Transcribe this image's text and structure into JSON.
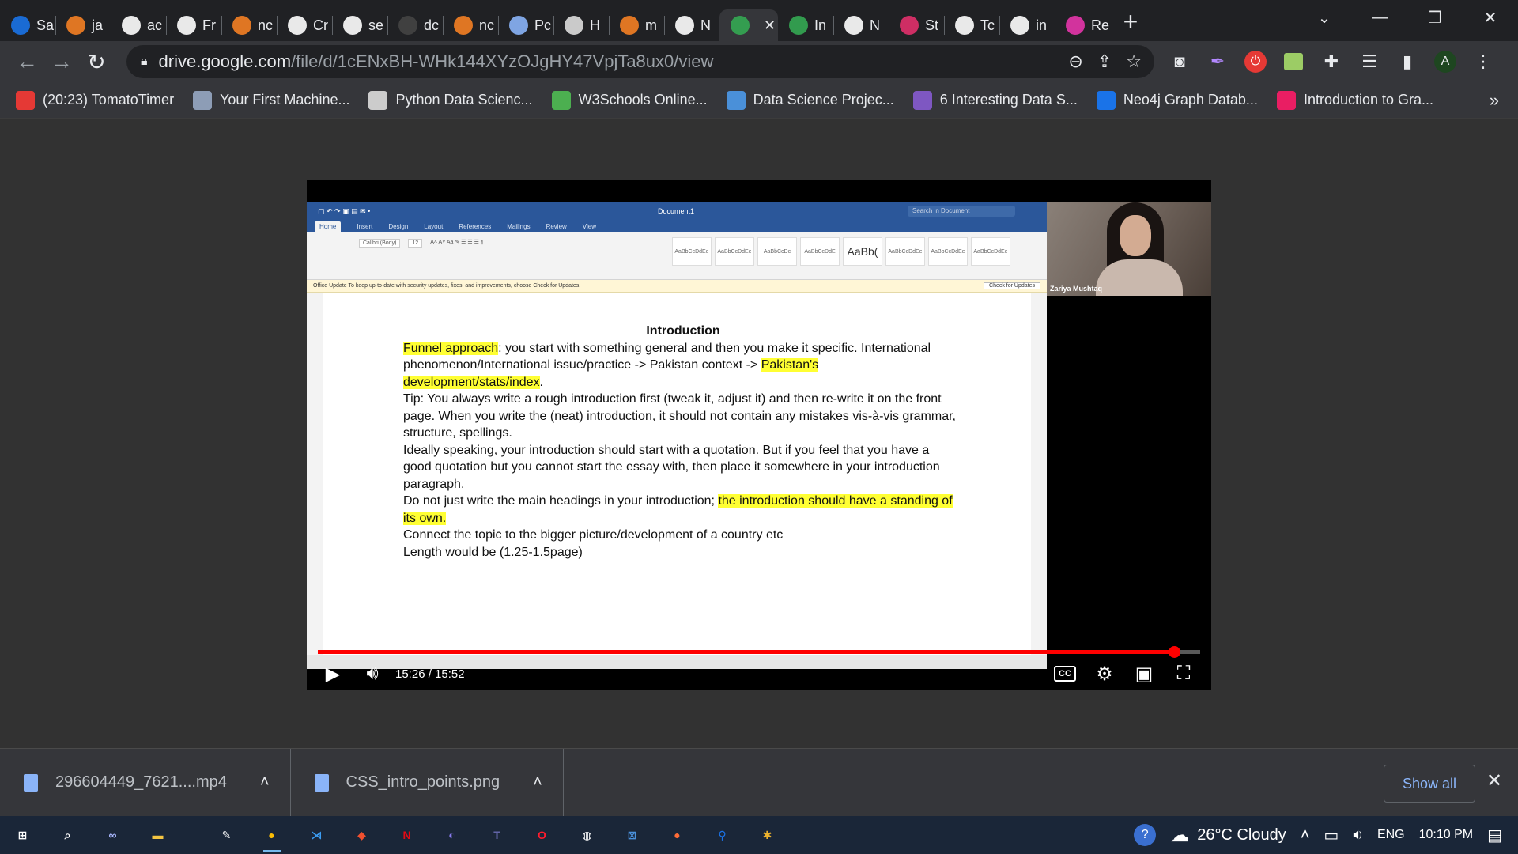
{
  "tabs": [
    {
      "label": "Sa",
      "icon": "diamond-icon",
      "color": "#1a73e8"
    },
    {
      "label": "ja",
      "icon": "stackoverflow-icon",
      "color": "#f48024"
    },
    {
      "label": "ac",
      "icon": "google-icon",
      "color": "#ffffff"
    },
    {
      "label": "Fr",
      "icon": "globe-icon",
      "color": "#ffffff"
    },
    {
      "label": "nc",
      "icon": "stackoverflow-icon",
      "color": "#f48024"
    },
    {
      "label": "Cr",
      "icon": "medium-icon",
      "color": "#ffffff"
    },
    {
      "label": "se",
      "icon": "google-icon",
      "color": "#ffffff"
    },
    {
      "label": "dc",
      "icon": "github-icon",
      "color": "#444444"
    },
    {
      "label": "nc",
      "icon": "stackoverflow-icon",
      "color": "#f48024"
    },
    {
      "label": "Pc",
      "icon": "stack-icon",
      "color": "#8ab4f8"
    },
    {
      "label": "H",
      "icon": "page-icon",
      "color": "#dddddd"
    },
    {
      "label": "m",
      "icon": "stackoverflow-icon",
      "color": "#f48024"
    },
    {
      "label": "N",
      "icon": "openai-icon",
      "color": "#ffffff"
    },
    {
      "label": "",
      "icon": "google-drive-icon",
      "color": "#34a853",
      "active": true
    },
    {
      "label": "In",
      "icon": "google-drive-icon",
      "color": "#34a853"
    },
    {
      "label": "N",
      "icon": "openai-icon",
      "color": "#ffffff"
    },
    {
      "label": "St",
      "icon": "instagram-icon",
      "color": "#e1306c"
    },
    {
      "label": "Tc",
      "icon": "dev-icon",
      "color": "#ffffff"
    },
    {
      "label": "in",
      "icon": "google-icon",
      "color": "#ffffff"
    },
    {
      "label": "Re",
      "icon": "relay-icon",
      "color": "#e535ab"
    }
  ],
  "toolbar": {
    "url_host": "drive.google.com",
    "url_path": "/file/d/1cENxBH-WHk144XYzOJgHY47VpjTa8ux0/view",
    "avatar_letter": "A"
  },
  "bookmarks": [
    {
      "label": "(20:23) TomatoTimer",
      "icon": "tomato-icon",
      "color": "#e53935"
    },
    {
      "label": "Your First Machine...",
      "icon": "book-icon",
      "color": "#8d9db6"
    },
    {
      "label": "Python Data Scienc...",
      "icon": "python-icon",
      "color": "#cccccc"
    },
    {
      "label": "W3Schools Online...",
      "icon": "w3schools-icon",
      "color": "#4caf50"
    },
    {
      "label": "Data Science Projec...",
      "icon": "project-icon",
      "color": "#4a90d9"
    },
    {
      "label": "6 Interesting Data S...",
      "icon": "article-icon",
      "color": "#7e57c2"
    },
    {
      "label": "Neo4j Graph Datab...",
      "icon": "neo4j-icon",
      "color": "#1a73e8"
    },
    {
      "label": "Introduction to Gra...",
      "icon": "video-icon",
      "color": "#e91e63"
    }
  ],
  "word": {
    "doc_name": "Document1",
    "search_placeholder": "Search in Document",
    "ribbon_tabs": [
      "Home",
      "Insert",
      "Design",
      "Layout",
      "References",
      "Mailings",
      "Review",
      "View"
    ],
    "font": "Calibri (Body)",
    "font_size": "12",
    "styles": [
      "AaBbCcDdEe",
      "AaBbCcDdEe",
      "AaBbCcDc",
      "AaBbCcDdE",
      "AaBb(",
      "AaBbCcDdEe",
      "AaBbCcDdEe",
      "AaBbCcDdEe"
    ],
    "update_text": "Office Update   To keep up-to-date with security updates, fixes, and improvements, choose Check for Updates.",
    "update_button": "Check for Updates",
    "doc": {
      "heading": "Introduction",
      "p1_hl": "Funnel approach",
      "p1_a": ": you start with something general and then you make it specific. International phenomenon/International issue/practice -> Pakistan context -> ",
      "p1_hl2": "Pakistan's development/stats/index",
      "p1_b": ".",
      "p2": "Tip: You always write a rough introduction first (tweak it, adjust it) and then re-write it on the front page. When you write the (neat) introduction, it should not contain any mistakes vis-à-vis grammar, structure, spellings.",
      "p3": "Ideally speaking, your introduction should start with a quotation. But if you feel that you have a good quotation but you cannot start the essay with, then place it somewhere in your introduction paragraph.",
      "p4_a": "Do not just write the main headings in your introduction; ",
      "p4_hl": "the introduction should have a standing of its own.",
      "p5": "Connect the topic to the bigger picture/development of a country etc",
      "p6": "Length would be (1.25-1.5page)"
    }
  },
  "participant": {
    "name": "Zariya Mushtaq"
  },
  "video": {
    "time": "15:26 / 15:52",
    "progress": 0.9706
  },
  "downloads": [
    {
      "name": "296604449_7621....mp4",
      "icon": "video-file-icon"
    },
    {
      "name": "CSS_intro_points.png",
      "icon": "image-file-icon"
    }
  ],
  "shelf": {
    "show_all": "Show all"
  },
  "taskbar": {
    "apps": [
      {
        "name": "start-icon",
        "glyph": "⊞",
        "color": "#ffffff"
      },
      {
        "name": "search-icon",
        "glyph": "⌕",
        "color": "#ffffff"
      },
      {
        "name": "task-view-icon",
        "glyph": "∞",
        "color": "#aab8ff"
      },
      {
        "name": "file-explorer-icon",
        "glyph": "▬",
        "color": "#f4c542"
      },
      {
        "name": "notepad-icon",
        "glyph": "✎",
        "color": "#ffffff"
      },
      {
        "name": "chrome-icon",
        "glyph": "●",
        "color": "#fbbc05",
        "active": true
      },
      {
        "name": "vscode-icon",
        "glyph": "⋊",
        "color": "#3c9df2"
      },
      {
        "name": "git-icon",
        "glyph": "◆",
        "color": "#f1502f"
      },
      {
        "name": "netflix-icon",
        "glyph": "N",
        "color": "#e50914"
      },
      {
        "name": "eclipse-icon",
        "glyph": "◐",
        "color": "#8a7cf0"
      },
      {
        "name": "teams-icon",
        "glyph": "T",
        "color": "#6264a7"
      },
      {
        "name": "opera-icon",
        "glyph": "O",
        "color": "#ff1b2d"
      },
      {
        "name": "app-icon",
        "glyph": "◍",
        "color": "#ffffff"
      },
      {
        "name": "ide-icon",
        "glyph": "⊠",
        "color": "#4a90d9"
      },
      {
        "name": "postman-icon",
        "glyph": "●",
        "color": "#ff6c37"
      },
      {
        "name": "maps-icon",
        "glyph": "⚲",
        "color": "#1a73e8"
      },
      {
        "name": "slack-icon",
        "glyph": "✱",
        "color": "#ecb22e"
      }
    ],
    "weather": "26°C  Cloudy",
    "lang": "ENG",
    "clock": "10:10 PM"
  }
}
